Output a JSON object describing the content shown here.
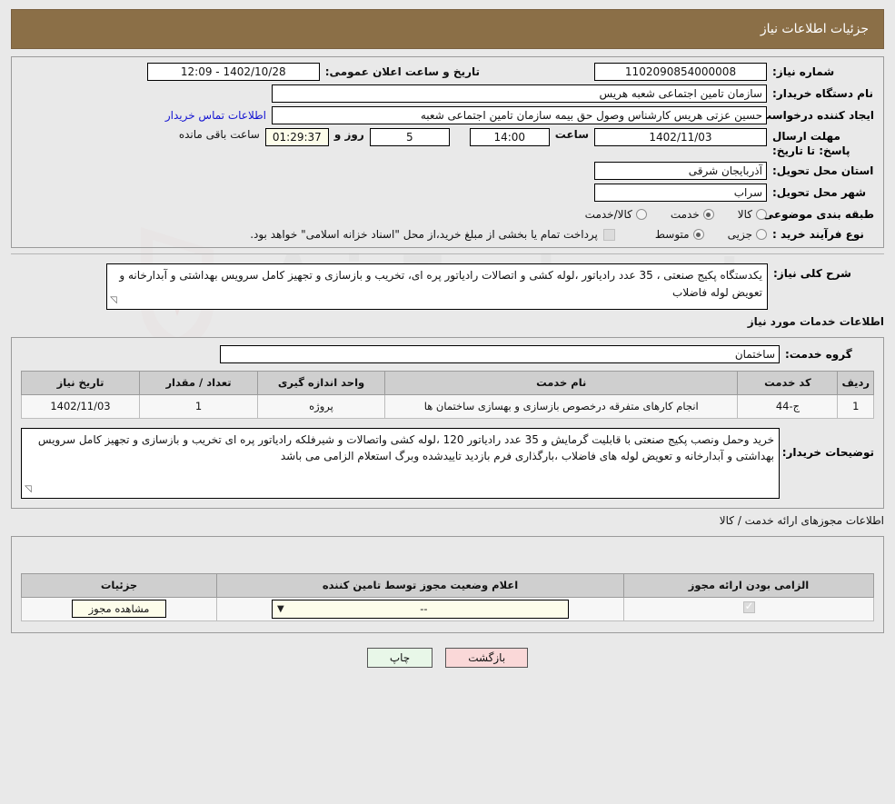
{
  "header": {
    "title": "جزئیات اطلاعات نیاز"
  },
  "summary": {
    "need_number_label": "شماره نیاز:",
    "need_number_value": "1102090854000008",
    "announce_label": "تاریخ و ساعت اعلان عمومی:",
    "announce_value": "1402/10/28 - 12:09",
    "buyer_org_label": "نام دستگاه خریدار:",
    "buyer_org_value": "سازمان تامین اجتماعی شعبه هریس",
    "requester_label": "ایجاد کننده درخواست:",
    "requester_value": "حسین  عزتی هریس  کارشناس وصول حق بیمه  سازمان تامین اجتماعی شعبه",
    "contact_link": "اطلاعات تماس خریدار",
    "deadline_label": "مهلت ارسال پاسخ: تا تاریخ:",
    "deadline_date": "1402/11/03",
    "hour_label": "ساعت",
    "deadline_time": "14:00",
    "days_value": "5",
    "days_label": "روز و",
    "remaining_time": "01:29:37",
    "remaining_label": "ساعت باقی مانده",
    "province_label": "استان محل تحویل:",
    "province_value": "آذربایجان شرقی",
    "city_label": "شهر محل تحویل:",
    "city_value": "سراب",
    "category_label": "طبقه بندی موضوعی:",
    "category_options": [
      "کالا",
      "خدمت",
      "کالا/خدمت"
    ],
    "category_selected": "خدمت",
    "process_label": "نوع فرآیند خرید :",
    "process_options": [
      "جزیی",
      "متوسط"
    ],
    "process_selected": "متوسط",
    "treasury_note": "پرداخت تمام یا بخشی از مبلغ خرید،از محل \"اسناد خزانه اسلامی\" خواهد بود.",
    "treasury_checked": false
  },
  "general_desc": {
    "label": "شرح کلی نیاز:",
    "value": "یکدستگاه پکیج صنعتی ، 35 عدد رادیاتور ،لوله کشی و اتصالات رادیاتور پره ای، تخریب و بازسازی و تجهیز کامل سرویس بهداشتی و آبدارخانه و تعویض لوله فاضلاب"
  },
  "services_section": {
    "title": "اطلاعات خدمات مورد نیاز",
    "group_label": "گروه خدمت:",
    "group_value": "ساختمان"
  },
  "services_table": {
    "columns": [
      "ردیف",
      "کد خدمت",
      "نام خدمت",
      "واحد اندازه گیری",
      "تعداد / مقدار",
      "تاریخ نیاز"
    ],
    "rows": [
      {
        "row": "1",
        "code": "ج-44",
        "name": "انجام کارهای متفرقه درخصوص بازسازی و بهسازی ساختمان ها",
        "unit": "پروژه",
        "quantity": "1",
        "date": "1402/11/03"
      }
    ]
  },
  "buyer_notes": {
    "label": "توضیحات خریدار:",
    "value": "خرید وحمل ونصب پکیج صنعتی با قابلیت گرمایش و 35 عدد رادیاتور 120 ،لوله کشی واتصالات و شیرفلکه رادیاتور پره ای تخریب و بازسازی و تجهیز کامل سرویس بهداشتی و آبدارخانه و تعویض لوله های فاضلاب ،بارگذاری فرم بازدید تاییدشده وبرگ استعلام الزامی می باشد"
  },
  "licenses": {
    "title": "اطلاعات مجوزهای ارائه خدمت / کالا",
    "columns": [
      "الزامی بودن ارائه مجوز",
      "اعلام وضعیت مجوز توسط تامین کننده",
      "جزئیات"
    ],
    "rows": [
      {
        "required_checked": true,
        "status_value": "--",
        "details_button": "مشاهده مجوز"
      }
    ]
  },
  "footer": {
    "print_label": "چاپ",
    "back_label": "بازگشت"
  },
  "watermark": {
    "text": "AriaTender.net"
  },
  "colors": {
    "header_bg": "#8b6f47",
    "link": "#1414d2",
    "page_bg": "#e9e9e9",
    "table_header": "#cfcfcf",
    "print_btn": "#e8f7e8",
    "back_btn": "#fad8d8",
    "cream_field": "#fdfdea"
  }
}
